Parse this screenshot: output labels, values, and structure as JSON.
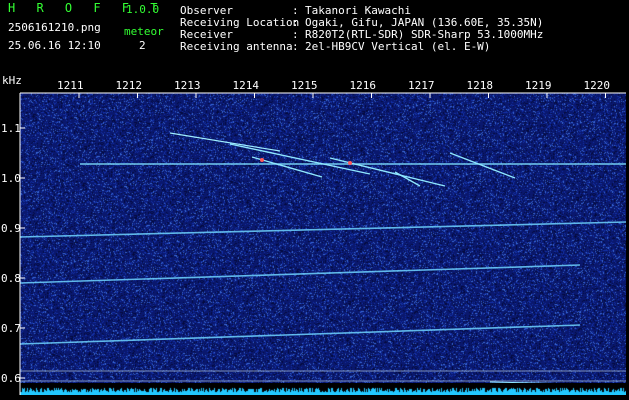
{
  "header": {
    "app_name": "H R O F F T",
    "version": "1.0.0",
    "filename": "2506161210.png",
    "timestamp": "25.06.16 12:10",
    "meteor_label": "meteor",
    "meteor_count": "2"
  },
  "info": [
    {
      "label": "Observer",
      "sep": ":",
      "value": "Takanori Kawachi"
    },
    {
      "label": "Receiving Location",
      "sep": ":",
      "value": "Ogaki, Gifu, JAPAN (136.60E, 35.35N)"
    },
    {
      "label": "Receiver",
      "sep": ":",
      "value": "R820T2(RTL-SDR) SDR-Sharp 53.1000MHz"
    },
    {
      "label": "Receiving antenna",
      "sep": ":",
      "value": "2el-HB9CV Vertical (el. E-W)"
    }
  ],
  "axis": {
    "y_unit": "kHz",
    "y_ticks": [
      "1.1",
      "1.0",
      "0.9",
      "0.8",
      "0.7",
      "0.6"
    ],
    "x_ticks": [
      "1211",
      "1212",
      "1213",
      "1214",
      "1215",
      "1216",
      "1217",
      "1218",
      "1219",
      "1220"
    ]
  },
  "colors": {
    "background": "#000000",
    "plot_noise": "#0a1a78",
    "header_green": "#33ff33",
    "header_white": "#ffffff",
    "trace": "#8fe8ff",
    "baseline": "#22c8ff"
  }
}
